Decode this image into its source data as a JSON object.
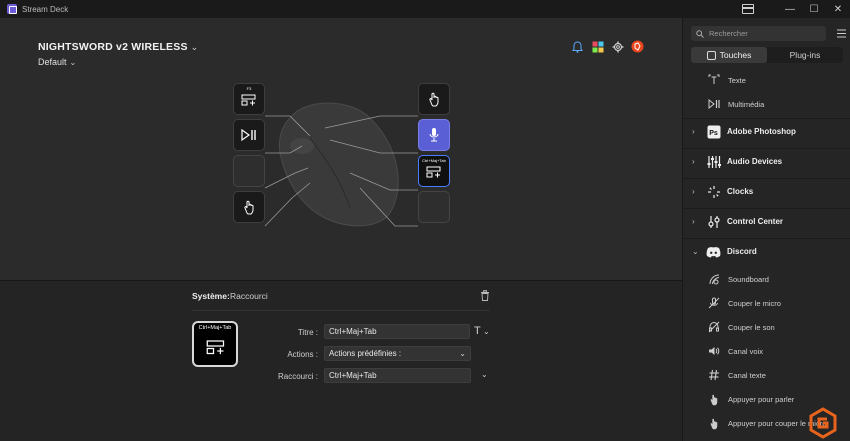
{
  "window": {
    "title": "Stream Deck",
    "minimize": "—",
    "maximize": "☐",
    "close": "✕"
  },
  "device": {
    "name": "NIGHTSWORD v2 WIRELESS",
    "profile": "Default"
  },
  "keys": {
    "top_left_label": "F3",
    "selected_label": "Ctrl+Maj+Tab"
  },
  "action": {
    "category": "Système:",
    "name": "Raccourci",
    "preview_label": "Ctrl+Maj+Tab",
    "fields": {
      "title_label": "Titre :",
      "title_value": "Ctrl+Maj+Tab",
      "actions_label": "Actions :",
      "actions_value": "Actions prédéfinies :",
      "shortcut_label": "Raccourci :",
      "shortcut_value": "Ctrl+Maj+Tab"
    }
  },
  "sidebar": {
    "search_placeholder": "Rechercher",
    "tabs": [
      "Touches",
      "Plug-ins"
    ],
    "items_top": [
      {
        "label": "Texte",
        "icon": "text-icon"
      },
      {
        "label": "Multimédia",
        "icon": "media-icon"
      }
    ],
    "categories": [
      {
        "label": "Adobe Photoshop",
        "icon": "photoshop-icon",
        "expanded": false
      },
      {
        "label": "Audio Devices",
        "icon": "audio-devices-icon",
        "expanded": false
      },
      {
        "label": "Clocks",
        "icon": "clocks-icon",
        "expanded": false
      },
      {
        "label": "Control Center",
        "icon": "control-center-icon",
        "expanded": false
      },
      {
        "label": "Discord",
        "icon": "discord-icon",
        "expanded": true
      }
    ],
    "discord_items": [
      {
        "label": "Soundboard",
        "icon": "soundboard-icon"
      },
      {
        "label": "Couper le micro",
        "icon": "mic-mute-icon"
      },
      {
        "label": "Couper le son",
        "icon": "sound-mute-icon"
      },
      {
        "label": "Canal voix",
        "icon": "voice-channel-icon"
      },
      {
        "label": "Canal texte",
        "icon": "text-channel-icon"
      },
      {
        "label": "Appuyer pour parler",
        "icon": "push-to-talk-icon"
      },
      {
        "label": "Appuyer pour couper le micro",
        "icon": "push-to-mute-icon"
      }
    ]
  },
  "colors": {
    "accent": "#5a5fd6",
    "selected_border": "#4a7dff",
    "brand": "#6b5bd6",
    "watermark": "#e8641c"
  }
}
